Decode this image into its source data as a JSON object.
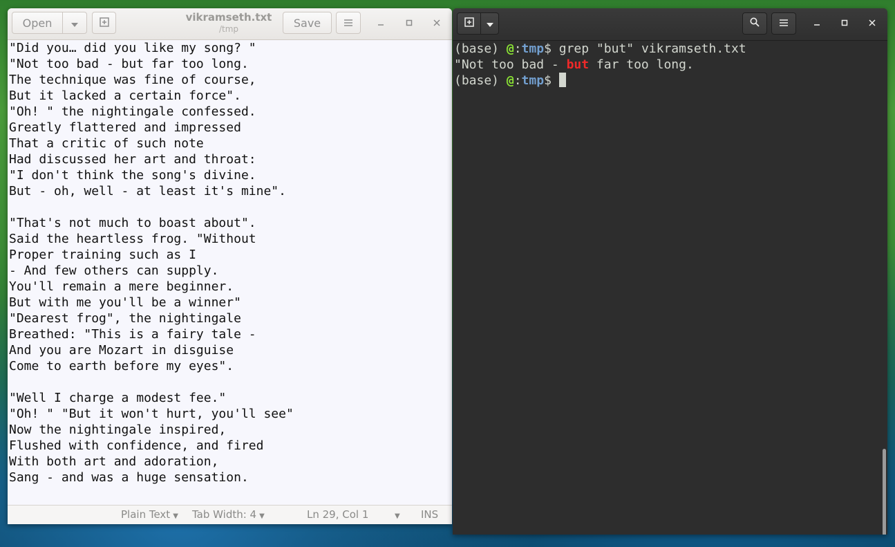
{
  "editor": {
    "title": "vikramseth.txt",
    "subtitle": "/tmp",
    "open_label": "Open",
    "save_label": "Save",
    "lines": [
      "\"Did you… did you like my song? \"",
      "\"Not too bad - but far too long.",
      "The technique was fine of course,",
      "But it lacked a certain force\".",
      "\"Oh! \" the nightingale confessed.",
      "Greatly flattered and impressed",
      "That a critic of such note",
      "Had discussed her art and throat:",
      "\"I don't think the song's divine.",
      "But - oh, well - at least it's mine\".",
      "",
      "\"That's not much to boast about\".",
      "Said the heartless frog. \"Without",
      "Proper training such as I",
      "- And few others can supply.",
      "You'll remain a mere beginner.",
      "But with me you'll be a winner\"",
      "\"Dearest frog\", the nightingale",
      "Breathed: \"This is a fairy tale -",
      "And you are Mozart in disguise",
      "Come to earth before my eyes\".",
      "",
      "\"Well I charge a modest fee.\"",
      "\"Oh! \" \"But it won't hurt, you'll see\"",
      "Now the nightingale inspired,",
      "Flushed with confidence, and fired",
      "With both art and adoration,",
      "Sang - and was a huge sensation.",
      ""
    ],
    "status": {
      "language": "Plain Text",
      "tab_width": "Tab Width: 4",
      "position": "Ln 29, Col 1",
      "mode": "INS"
    }
  },
  "terminal": {
    "prompt_env": "(base) ",
    "prompt_at": "@",
    "prompt_sep": ":",
    "prompt_dir": "tmp",
    "prompt_end": "$ ",
    "command": "grep \"but\" vikramseth.txt",
    "output_before": "\"Not too bad - ",
    "output_match": "but",
    "output_after": " far too long."
  },
  "colors": {
    "match": "#ef2929",
    "prompt_at": "#8ae234",
    "prompt_dir": "#729fcf",
    "terminal_bg": "#2d2d2d",
    "editor_bg": "#f7f7fd"
  }
}
